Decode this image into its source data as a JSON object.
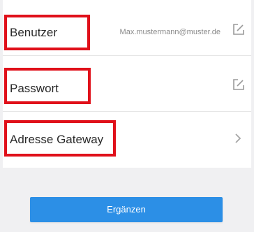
{
  "settings": {
    "rows": {
      "user": {
        "label": "Benutzer",
        "value": "Max.mustermann@muster.de",
        "icon": "edit-icon"
      },
      "password": {
        "label": "Passwort",
        "icon": "edit-icon"
      },
      "gateway": {
        "label": "Adresse Gateway",
        "icon": "chevron-right-icon"
      }
    },
    "primary_button": {
      "label": "Ergänzen"
    }
  },
  "colors": {
    "highlight": "#e0101a",
    "button": "#2c8fe6"
  }
}
